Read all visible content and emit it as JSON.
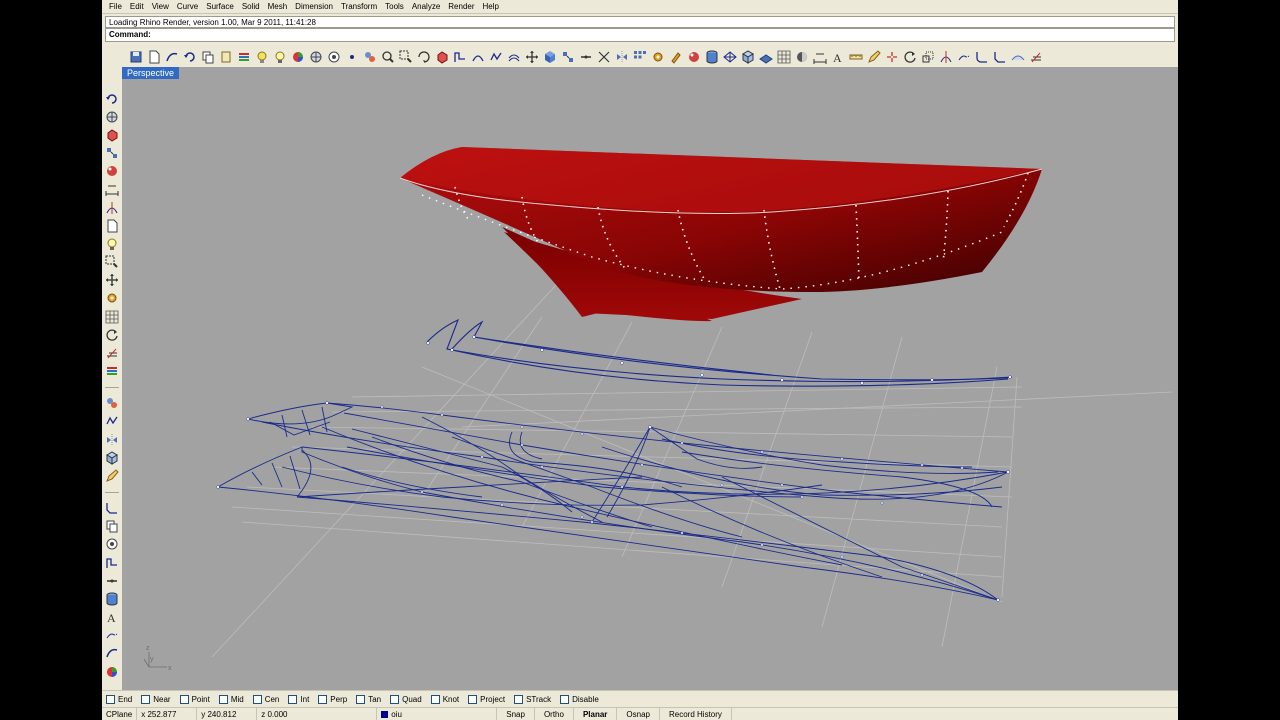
{
  "menu": [
    "File",
    "Edit",
    "View",
    "Curve",
    "Surface",
    "Solid",
    "Mesh",
    "Dimension",
    "Transform",
    "Tools",
    "Analyze",
    "Render",
    "Help"
  ],
  "command": {
    "history": "Loading Rhino Render, version 1.00, Mar  9 2011, 11:41:28",
    "label": "Command:",
    "value": ""
  },
  "viewport": {
    "tab_label": "Perspective"
  },
  "toolbar_top_icons": [
    "save-icon",
    "new-icon",
    "curve-from-objects-icon",
    "undo-icon",
    "copy-icon",
    "paste-icon",
    "layers-icon",
    "properties-icon",
    "light-bulb-icon",
    "color-wheel-icon",
    "globe-icon",
    "render-icon",
    "point-icon",
    "group-icon",
    "zoom-icon",
    "zoom-window-icon",
    "rotate-view-icon",
    "box-icon",
    "polyline-icon",
    "arc-icon",
    "rebuild-icon",
    "offset-icon",
    "move-icon",
    "boolean-icon",
    "explode-icon",
    "join-icon",
    "split-icon",
    "mirror-icon",
    "array-icon",
    "gear-icon",
    "paint-icon",
    "material-icon",
    "cylinder-icon",
    "mesh-icon",
    "cube-icon",
    "plane-icon",
    "grid-icon",
    "shade-icon",
    "dimension-icon",
    "text-icon",
    "ruler-icon",
    "pencil-icon",
    "snap-icon",
    "rotate-icon",
    "scale-icon",
    "trim-icon",
    "extend-icon",
    "fillet-icon",
    "chamfer-icon",
    "surface-icon",
    "layer-off-icon"
  ],
  "toolbar_side_icons": [
    "point-icon",
    "line-icon",
    "polyline-icon",
    "curve-icon",
    "rectangle-icon",
    "circle-icon",
    "arc-icon",
    "ellipse-icon",
    "polygon-icon",
    "freeform-icon",
    "blend-icon",
    "extrude-icon",
    "loft-icon",
    "revolve-icon",
    "sweep-icon",
    "patch-icon",
    "box-icon",
    "sphere-icon",
    "cylinder-icon",
    "cone-icon",
    "torus-icon",
    "move-icon",
    "copy-icon",
    "rotate-icon",
    "scale-icon",
    "mirror-icon",
    "array-icon",
    "trim-icon",
    "split-icon",
    "join-icon",
    "explode-icon"
  ],
  "osnap": [
    {
      "label": "End",
      "checked": false
    },
    {
      "label": "Near",
      "checked": false
    },
    {
      "label": "Point",
      "checked": false
    },
    {
      "label": "Mid",
      "checked": false
    },
    {
      "label": "Cen",
      "checked": false
    },
    {
      "label": "Int",
      "checked": false
    },
    {
      "label": "Perp",
      "checked": false
    },
    {
      "label": "Tan",
      "checked": false
    },
    {
      "label": "Quad",
      "checked": false
    },
    {
      "label": "Knot",
      "checked": false
    },
    {
      "label": "Project",
      "checked": false
    },
    {
      "label": "STrack",
      "checked": false
    },
    {
      "label": "Disable",
      "checked": false
    }
  ],
  "status": {
    "cplane": "CPlane",
    "x": "x 252.877",
    "y": "y 240.812",
    "z": "z 0.000",
    "layer": "oiu",
    "layer_color": "#00008b",
    "snap": "Snap",
    "ortho": "Ortho",
    "planar": "Planar",
    "osnap": "Osnap",
    "record_history": "Record History"
  },
  "colors": {
    "hull": "#8b0000",
    "wire": "#1a2a8c",
    "viewport_bg": "#a2a2a2",
    "tab_bg": "#316ac5"
  }
}
